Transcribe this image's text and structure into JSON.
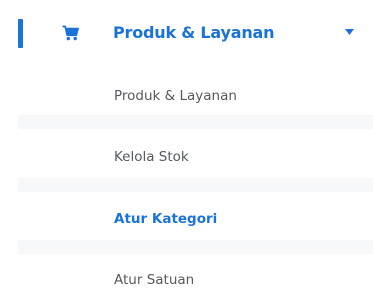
{
  "menu": {
    "parent": {
      "label": "Produk & Layanan",
      "icon": "cart-icon",
      "expand_icon": "caret-down-icon",
      "expanded": true
    },
    "accent_color": "#1a73d8",
    "text_color": "#555a60",
    "items": [
      {
        "label": "Produk & Layanan",
        "active": false
      },
      {
        "label": "Kelola Stok",
        "active": false
      },
      {
        "label": "Atur Kategori",
        "active": true
      },
      {
        "label": "Atur Satuan",
        "active": false
      }
    ]
  }
}
